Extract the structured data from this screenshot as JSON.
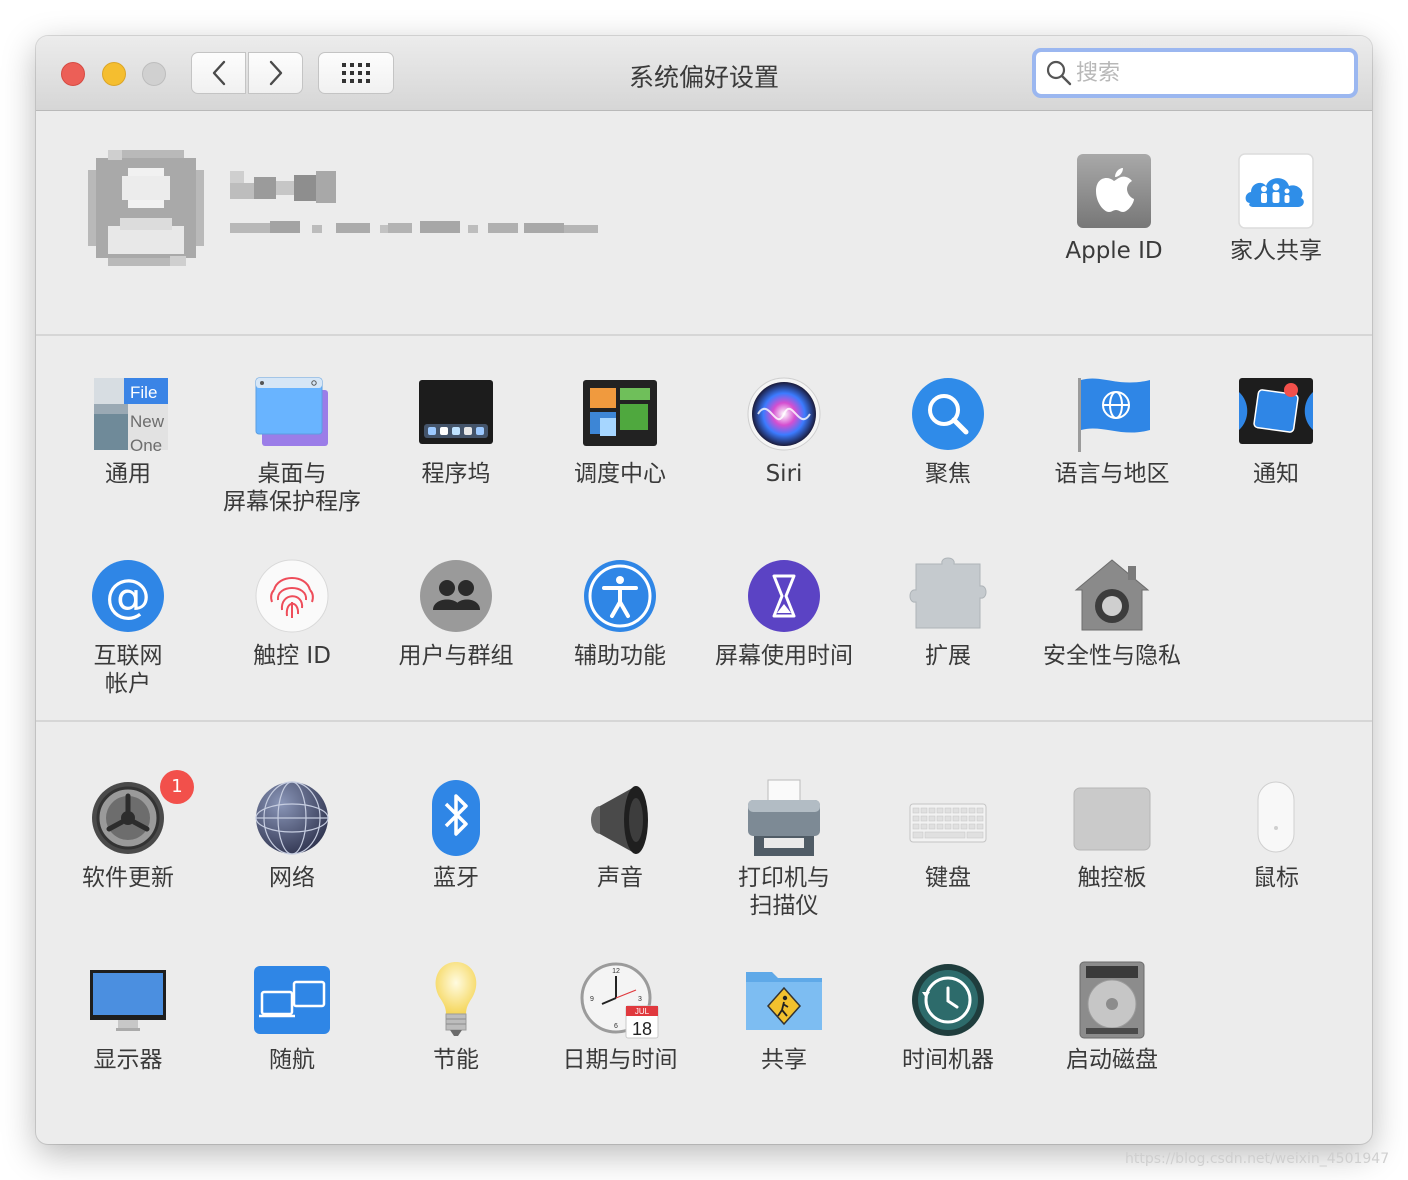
{
  "window": {
    "title": "系统偏好设置"
  },
  "search": {
    "placeholder": "搜索",
    "value": ""
  },
  "account": {
    "name": "",
    "apple_id_label": "Apple ID",
    "family_label": "家人共享"
  },
  "row1": [
    {
      "label": "通用",
      "icon": "general-icon"
    },
    {
      "label": "桌面与\n屏幕保护程序",
      "icon": "desktop-icon"
    },
    {
      "label": "程序坞",
      "icon": "dock-icon"
    },
    {
      "label": "调度中心",
      "icon": "mission-control-icon"
    },
    {
      "label": "Siri",
      "icon": "siri-icon"
    },
    {
      "label": "聚焦",
      "icon": "spotlight-icon"
    },
    {
      "label": "语言与地区",
      "icon": "language-flag-icon"
    },
    {
      "label": "通知",
      "icon": "notifications-icon"
    }
  ],
  "row2": [
    {
      "label": "互联网\n帐户",
      "icon": "internet-accounts-icon"
    },
    {
      "label": "触控 ID",
      "icon": "touch-id-icon"
    },
    {
      "label": "用户与群组",
      "icon": "users-icon"
    },
    {
      "label": "辅助功能",
      "icon": "accessibility-icon"
    },
    {
      "label": "屏幕使用时间",
      "icon": "screen-time-icon"
    },
    {
      "label": "扩展",
      "icon": "extensions-icon"
    },
    {
      "label": "安全性与隐私",
      "icon": "security-icon"
    }
  ],
  "row3": [
    {
      "label": "软件更新",
      "icon": "software-update-icon",
      "badge": "1"
    },
    {
      "label": "网络",
      "icon": "network-icon"
    },
    {
      "label": "蓝牙",
      "icon": "bluetooth-icon"
    },
    {
      "label": "声音",
      "icon": "sound-icon"
    },
    {
      "label": "打印机与\n扫描仪",
      "icon": "printer-icon"
    },
    {
      "label": "键盘",
      "icon": "keyboard-icon"
    },
    {
      "label": "触控板",
      "icon": "trackpad-icon"
    },
    {
      "label": "鼠标",
      "icon": "mouse-icon"
    }
  ],
  "row4": [
    {
      "label": "显示器",
      "icon": "display-icon"
    },
    {
      "label": "随航",
      "icon": "sidecar-icon"
    },
    {
      "label": "节能",
      "icon": "energy-saver-icon"
    },
    {
      "label": "日期与时间",
      "icon": "date-time-icon"
    },
    {
      "label": "共享",
      "icon": "sharing-icon"
    },
    {
      "label": "时间机器",
      "icon": "time-machine-icon"
    },
    {
      "label": "启动磁盘",
      "icon": "startup-disk-icon"
    }
  ],
  "icon_text": {
    "general": [
      "File",
      "New",
      "One"
    ],
    "calendar_month": "JUL",
    "calendar_day": "18"
  },
  "watermark": "https://blog.csdn.net/weixin_4501947"
}
